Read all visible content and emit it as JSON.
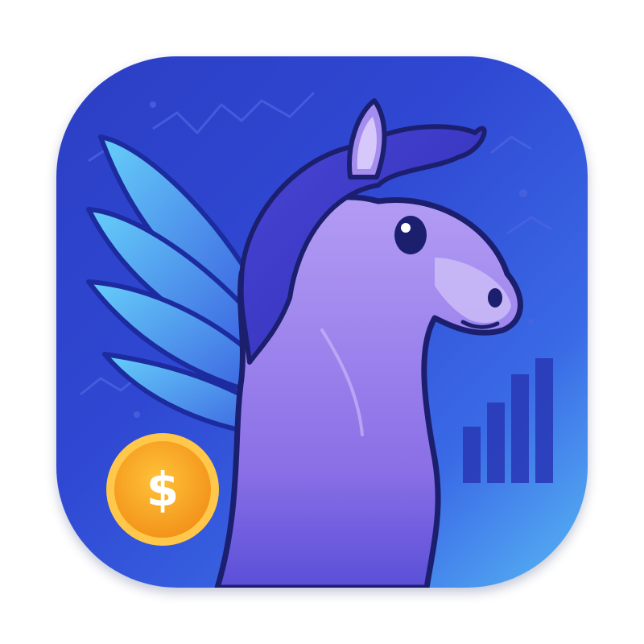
{
  "app_icon": {
    "subject": "pegasus",
    "coin_symbol": "$",
    "icons": [
      "pegasus-icon",
      "wing-icon",
      "coin-icon",
      "bar-chart-icon",
      "trend-line-icon"
    ],
    "colors": {
      "background_start": "#2c3fc4",
      "background_end": "#58b8f4",
      "horse_body": "#a58df0",
      "horse_mane": "#3a38c8",
      "wing_light": "#5fc4f8",
      "wing_dark": "#3f6ae6",
      "outline": "#1c1f6e",
      "coin_fill": "#f6a71c",
      "coin_rim": "#ffc84a",
      "bars": "#2a3ab8"
    }
  }
}
